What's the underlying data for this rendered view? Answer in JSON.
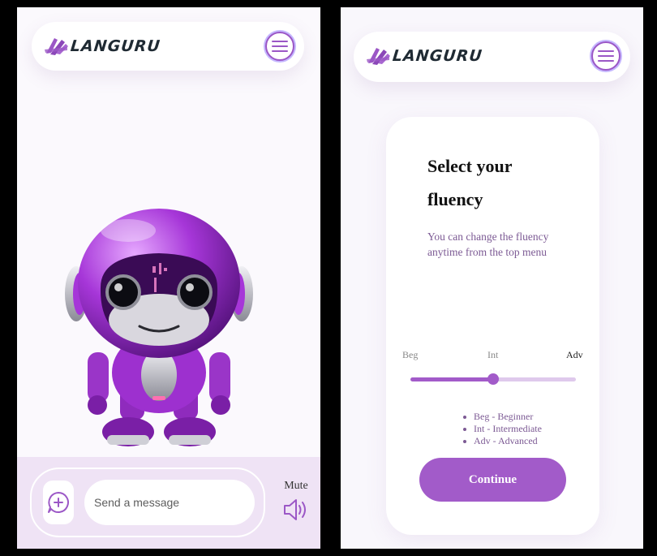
{
  "brand": {
    "name": "LANGURU"
  },
  "chat": {
    "input_placeholder": "Send a message",
    "mute_label": "Mute"
  },
  "fluency": {
    "title": "Select your fluency",
    "description": "You can change the fluency anytime from the top menu",
    "levels": [
      "Beg",
      "Int",
      "Adv"
    ],
    "selected_level": "Int",
    "slider_value_fraction": 0.5,
    "legend": [
      "Beg - Beginner",
      "Int - Intermediate",
      "Adv - Advanced"
    ],
    "continue_label": "Continue"
  },
  "colors": {
    "accent": "#a25bc9",
    "accent_light": "#dfc9ec",
    "text_dark": "#1f2a33"
  },
  "icons": [
    "logo-brush-icon",
    "hamburger-menu-icon",
    "add-chat-icon",
    "speaker-icon"
  ]
}
